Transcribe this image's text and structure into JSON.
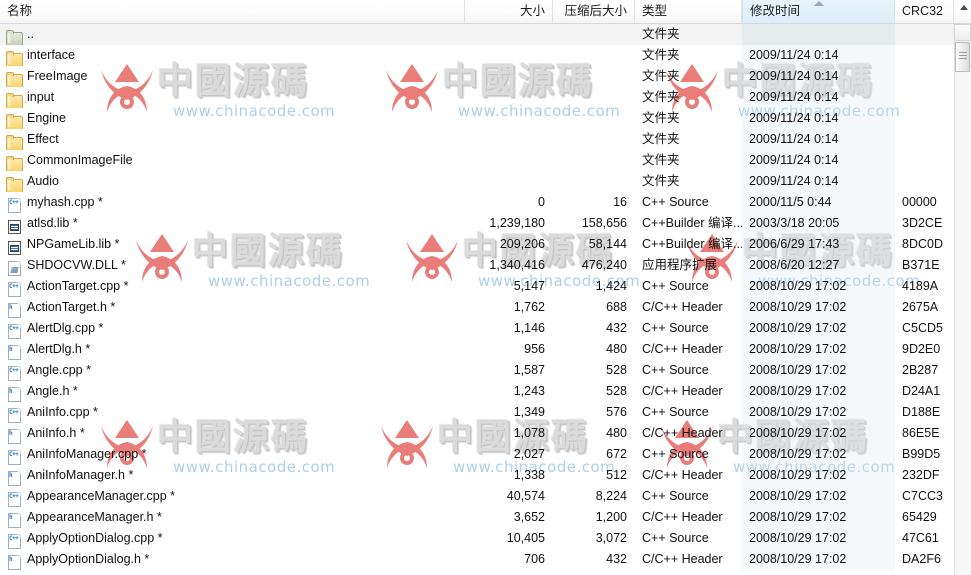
{
  "columns": [
    {
      "key": "name",
      "label": "名称",
      "align": "left"
    },
    {
      "key": "size",
      "label": "大小",
      "align": "right"
    },
    {
      "key": "packed",
      "label": "压缩后大小",
      "align": "right"
    },
    {
      "key": "type",
      "label": "类型",
      "align": "left"
    },
    {
      "key": "date",
      "label": "修改时间",
      "align": "left",
      "sorted": true,
      "sort_direction": "ascending"
    },
    {
      "key": "crc",
      "label": "CRC32",
      "align": "left",
      "truncated": true
    }
  ],
  "scrollbar": {
    "up_arrow": "▲",
    "thumb_grip": "grip-lines",
    "position": "top"
  },
  "watermark": {
    "text_cn": "中國源碼",
    "url": "www.chinacode.com",
    "logo_color": "#e8736e",
    "text_color": "#d9d9d9"
  },
  "rows": [
    {
      "icon": "folder-up",
      "name": "..",
      "size": "",
      "packed": "",
      "type": "文件夹",
      "date": "",
      "crc": "",
      "selected": true
    },
    {
      "icon": "folder",
      "name": "interface",
      "size": "",
      "packed": "",
      "type": "文件夹",
      "date": "2009/11/24 0:14",
      "crc": ""
    },
    {
      "icon": "folder",
      "name": "FreeImage",
      "size": "",
      "packed": "",
      "type": "文件夹",
      "date": "2009/11/24 0:14",
      "crc": ""
    },
    {
      "icon": "folder",
      "name": "input",
      "size": "",
      "packed": "",
      "type": "文件夹",
      "date": "2009/11/24 0:14",
      "crc": ""
    },
    {
      "icon": "folder",
      "name": "Engine",
      "size": "",
      "packed": "",
      "type": "文件夹",
      "date": "2009/11/24 0:14",
      "crc": ""
    },
    {
      "icon": "folder",
      "name": "Effect",
      "size": "",
      "packed": "",
      "type": "文件夹",
      "date": "2009/11/24 0:14",
      "crc": ""
    },
    {
      "icon": "folder",
      "name": "CommonImageFile",
      "size": "",
      "packed": "",
      "type": "文件夹",
      "date": "2009/11/24 0:14",
      "crc": ""
    },
    {
      "icon": "folder",
      "name": "Audio",
      "size": "",
      "packed": "",
      "type": "文件夹",
      "date": "2009/11/24 0:14",
      "crc": ""
    },
    {
      "icon": "cpp",
      "name": "myhash.cpp *",
      "size": "0",
      "packed": "16",
      "type": "C++ Source",
      "date": "2000/11/5 0:44",
      "crc": "00000"
    },
    {
      "icon": "lib",
      "name": "atlsd.lib *",
      "size": "1,239,180",
      "packed": "158,656",
      "type": "C++Builder 编译...",
      "date": "2003/3/18 20:05",
      "crc": "3D2CE"
    },
    {
      "icon": "lib",
      "name": "NPGameLib.lib *",
      "size": "209,206",
      "packed": "58,144",
      "type": "C++Builder 编译...",
      "date": "2006/6/29 17:43",
      "crc": "8DC0D"
    },
    {
      "icon": "dll",
      "name": "SHDOCVW.DLL *",
      "size": "1,340,416",
      "packed": "476,240",
      "type": "应用程序扩展",
      "date": "2008/6/20 12:27",
      "crc": "B371E"
    },
    {
      "icon": "cpp",
      "name": "ActionTarget.cpp *",
      "size": "5,147",
      "packed": "1,424",
      "type": "C++ Source",
      "date": "2008/10/29 17:02",
      "crc": "4189A"
    },
    {
      "icon": "h",
      "name": "ActionTarget.h *",
      "size": "1,762",
      "packed": "688",
      "type": "C/C++ Header",
      "date": "2008/10/29 17:02",
      "crc": "2675A"
    },
    {
      "icon": "cpp",
      "name": "AlertDlg.cpp *",
      "size": "1,146",
      "packed": "432",
      "type": "C++ Source",
      "date": "2008/10/29 17:02",
      "crc": "C5CD5"
    },
    {
      "icon": "h",
      "name": "AlertDlg.h *",
      "size": "956",
      "packed": "480",
      "type": "C/C++ Header",
      "date": "2008/10/29 17:02",
      "crc": "9D2E0"
    },
    {
      "icon": "cpp",
      "name": "Angle.cpp *",
      "size": "1,587",
      "packed": "528",
      "type": "C++ Source",
      "date": "2008/10/29 17:02",
      "crc": "2B287"
    },
    {
      "icon": "h",
      "name": "Angle.h *",
      "size": "1,243",
      "packed": "528",
      "type": "C/C++ Header",
      "date": "2008/10/29 17:02",
      "crc": "D24A1"
    },
    {
      "icon": "cpp",
      "name": "AniInfo.cpp *",
      "size": "1,349",
      "packed": "576",
      "type": "C++ Source",
      "date": "2008/10/29 17:02",
      "crc": "D188E"
    },
    {
      "icon": "h",
      "name": "AniInfo.h *",
      "size": "1,078",
      "packed": "480",
      "type": "C/C++ Header",
      "date": "2008/10/29 17:02",
      "crc": "86E5E"
    },
    {
      "icon": "cpp",
      "name": "AniInfoManager.cpp *",
      "size": "2,027",
      "packed": "672",
      "type": "C++ Source",
      "date": "2008/10/29 17:02",
      "crc": "B99D5"
    },
    {
      "icon": "h",
      "name": "AniInfoManager.h *",
      "size": "1,338",
      "packed": "512",
      "type": "C/C++ Header",
      "date": "2008/10/29 17:02",
      "crc": "232DF"
    },
    {
      "icon": "cpp",
      "name": "AppearanceManager.cpp *",
      "size": "40,574",
      "packed": "8,224",
      "type": "C++ Source",
      "date": "2008/10/29 17:02",
      "crc": "C7CC3"
    },
    {
      "icon": "h",
      "name": "AppearanceManager.h *",
      "size": "3,652",
      "packed": "1,200",
      "type": "C/C++ Header",
      "date": "2008/10/29 17:02",
      "crc": "65429"
    },
    {
      "icon": "cpp",
      "name": "ApplyOptionDialog.cpp *",
      "size": "10,405",
      "packed": "3,072",
      "type": "C++ Source",
      "date": "2008/10/29 17:02",
      "crc": "47C61"
    },
    {
      "icon": "h",
      "name": "ApplyOptionDialog.h *",
      "size": "706",
      "packed": "432",
      "type": "C/C++ Header",
      "date": "2008/10/29 17:02",
      "crc": "DA2F6"
    }
  ]
}
